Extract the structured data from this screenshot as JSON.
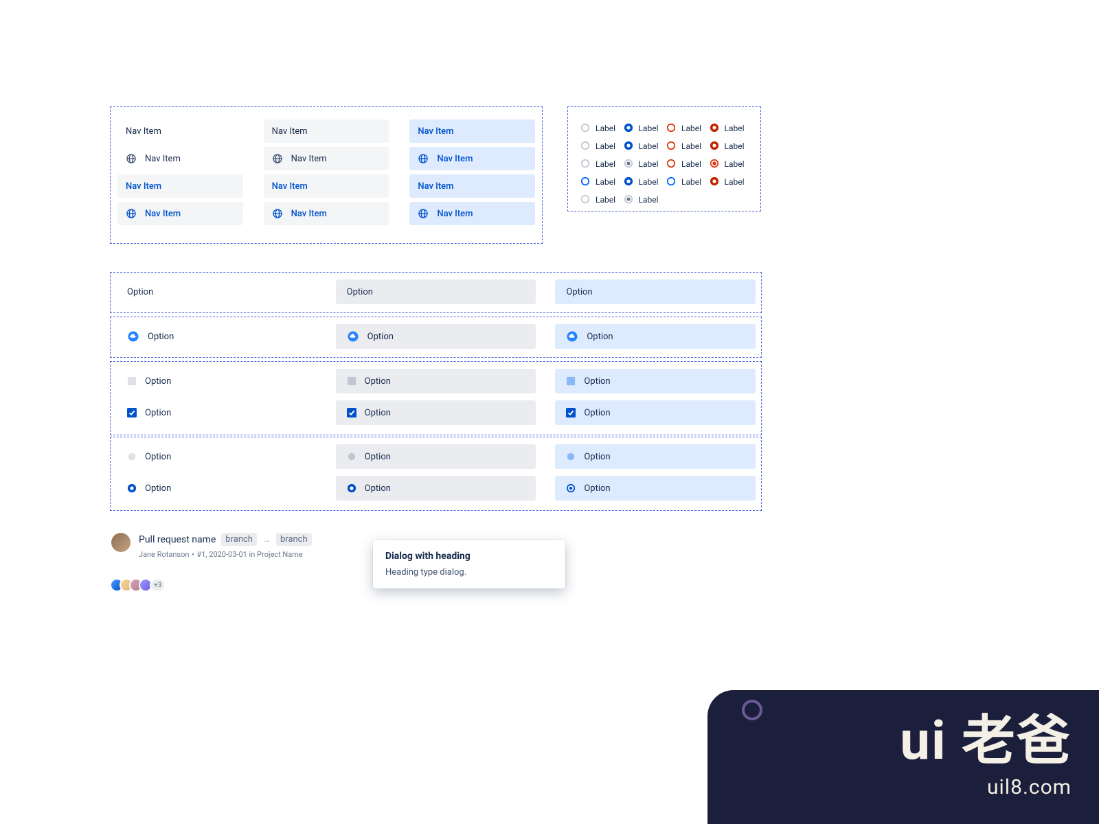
{
  "nav": {
    "label": "Nav Item"
  },
  "radio": {
    "label": "Label"
  },
  "option": {
    "label": "Option"
  },
  "pr": {
    "title": "Pull request name",
    "branch_from": "branch",
    "branch_to": "branch",
    "meta": "Jane Rotanson・#1, 2020-03-01 in Project Name"
  },
  "avatar_group": {
    "more": "+3"
  },
  "dialog": {
    "title": "Dialog with heading",
    "body": "Heading type dialog."
  },
  "watermark": {
    "main": "ui 老爸",
    "sub": "uil8.com"
  }
}
